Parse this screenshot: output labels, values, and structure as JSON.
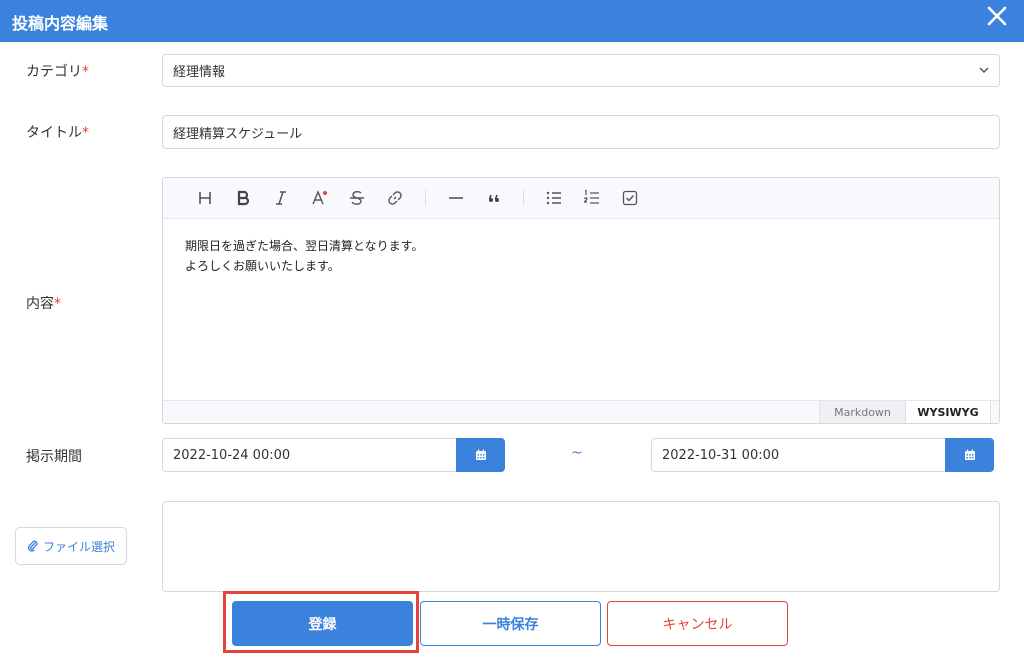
{
  "header": {
    "title": "投稿内容編集",
    "close_icon": "close-icon"
  },
  "form": {
    "category": {
      "label": "カテゴリ",
      "required_mark": "*",
      "value": "経理情報"
    },
    "title": {
      "label": "タイトル",
      "required_mark": "*",
      "value": "経理精算スケジュール"
    },
    "content": {
      "label": "内容",
      "required_mark": "*",
      "toolbar": [
        "heading-icon",
        "bold-icon",
        "italic-icon",
        "text-color-icon",
        "strikethrough-icon",
        "link-icon",
        "horizontal-rule-icon",
        "quote-icon",
        "bullet-list-icon",
        "ordered-list-icon",
        "task-list-icon"
      ],
      "lines": [
        "期限日を過ぎた場合、翌日清算となります。",
        "よろしくお願いいたします。"
      ],
      "mode_markdown": "Markdown",
      "mode_wysiwyg": "WYSIWYG"
    },
    "period": {
      "label": "掲示期間",
      "start": "2022-10-24 00:00",
      "end": "2022-10-31 00:00",
      "separator": "~"
    },
    "file": {
      "button_label": "ファイル選択"
    }
  },
  "buttons": {
    "submit": "登録",
    "save_draft": "一時保存",
    "cancel": "キャンセル"
  },
  "colors": {
    "primary": "#3b82dc",
    "danger": "#e0443a"
  }
}
